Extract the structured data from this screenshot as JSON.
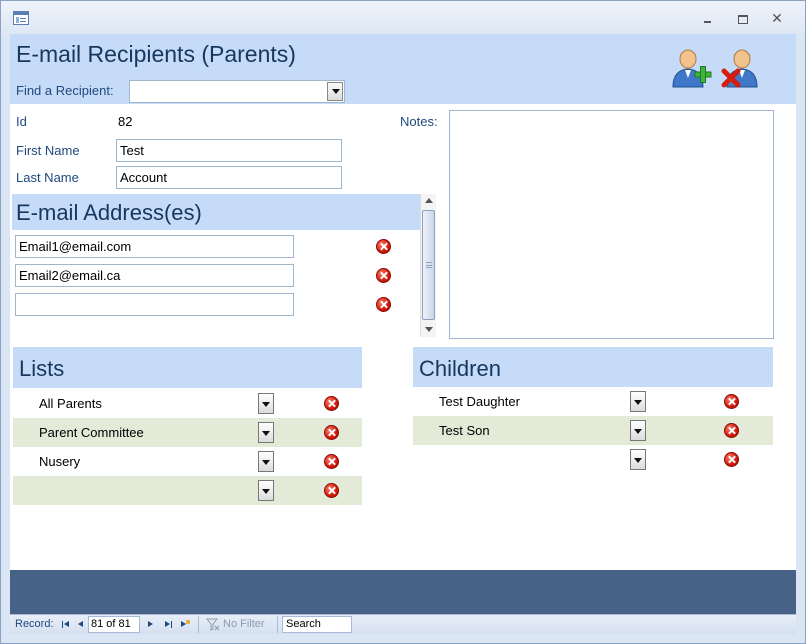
{
  "window": {
    "minimize_glyph": "",
    "maximize_glyph": "",
    "close_glyph": "✕"
  },
  "header": {
    "title": "E-mail Recipients (Parents)",
    "find_label": "Find a Recipient:",
    "find_value": "",
    "icons": [
      "add-person-icon",
      "delete-person-icon"
    ]
  },
  "record": {
    "id_label": "Id",
    "id_value": "82",
    "first_name_label": "First Name",
    "first_name_value": "Test",
    "last_name_label": "Last Name",
    "last_name_value": "Account",
    "notes_label": "Notes:",
    "notes_value": ""
  },
  "emails": {
    "title": "E-mail Address(es)",
    "items": [
      "Email1@email.com",
      "Email2@email.ca",
      ""
    ]
  },
  "lists": {
    "title": "Lists",
    "items": [
      "All Parents",
      "Parent Committee",
      "Nusery",
      ""
    ]
  },
  "children": {
    "title": "Children",
    "items": [
      "Test Daughter",
      "Test Son",
      ""
    ]
  },
  "navigation": {
    "record_label": "Record:",
    "record_position": "81 of 81",
    "filter_label": "No Filter",
    "search_label": "Search"
  },
  "colors": {
    "header_band": "#c5dbf7",
    "title_text": "#17375e",
    "alt_row": "#e3ead8",
    "footer_band": "#466286",
    "delete_red": "#d01a0a"
  }
}
